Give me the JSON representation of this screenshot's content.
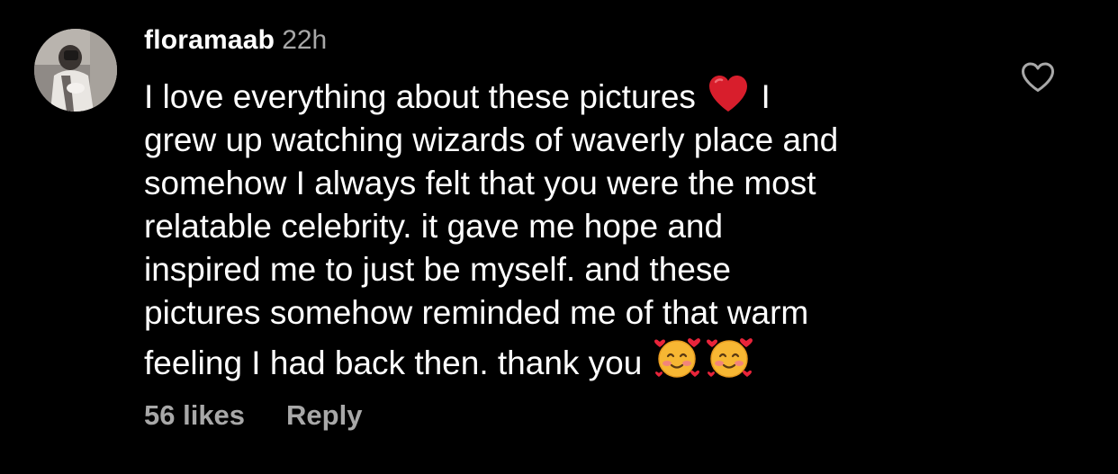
{
  "comment": {
    "username": "floramaab",
    "timestamp": "22h",
    "text_lines": [
      {
        "before": "I love everything about these pictures ",
        "emoji": "red-heart",
        "after": " I"
      },
      {
        "text": "grew up watching wizards of waverly place and"
      },
      {
        "text": "somehow I always felt that you were the most"
      },
      {
        "text": "relatable celebrity. it gave me hope and"
      },
      {
        "text": "inspired me to just be myself. and these"
      },
      {
        "text": "pictures somehow reminded me of that warm"
      },
      {
        "before": "feeling I had back then. thank you ",
        "emoji": "smiling-face-with-hearts",
        "after": ""
      }
    ],
    "likes": "56 likes",
    "reply_label": "Reply",
    "like_icon": "heart-outline-icon"
  },
  "colors": {
    "background": "#000000",
    "primary_text": "#ffffff",
    "secondary_text": "#a8a8a8",
    "heart_red": "#d81e2c"
  }
}
